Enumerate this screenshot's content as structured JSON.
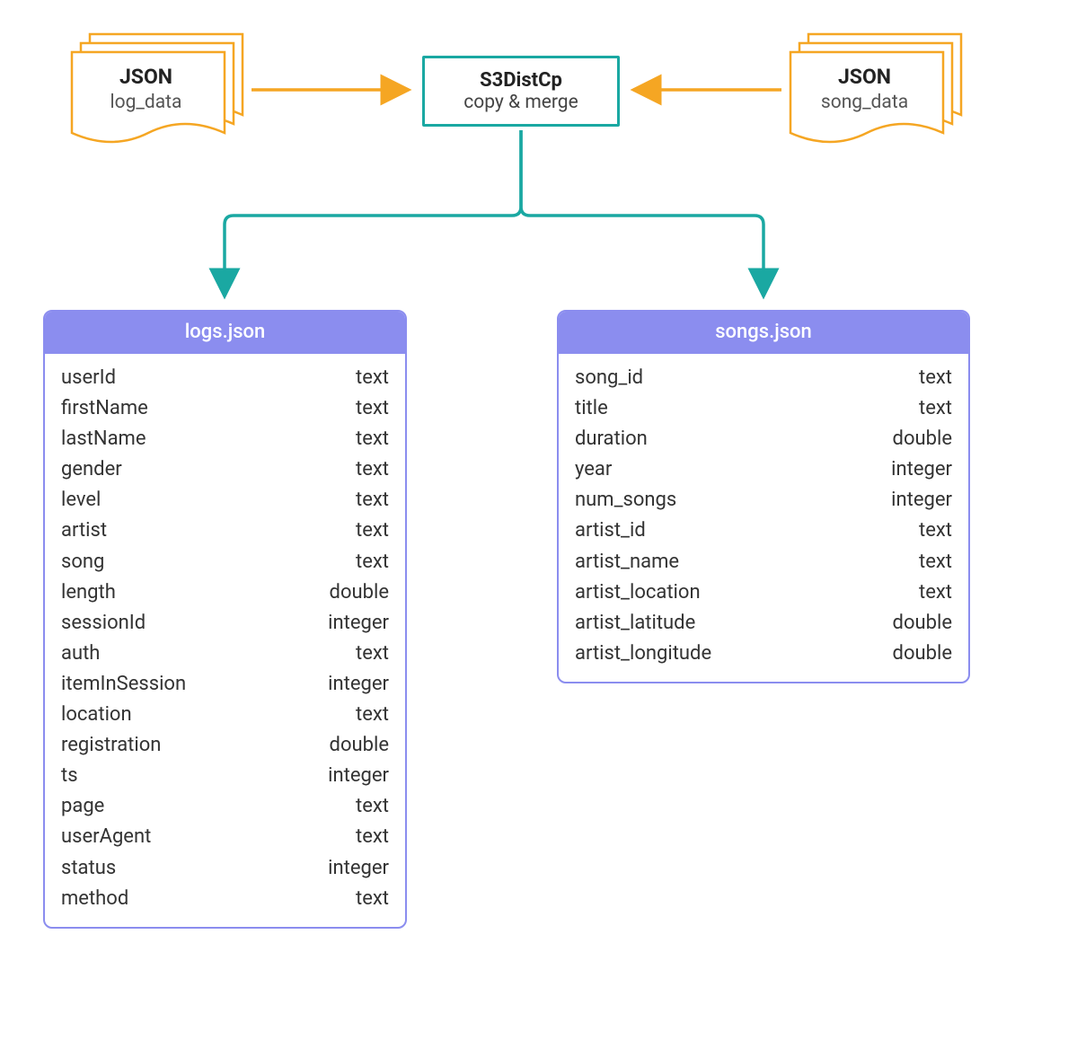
{
  "source_left": {
    "title": "JSON",
    "subtitle": "log_data"
  },
  "source_right": {
    "title": "JSON",
    "subtitle": "song_data"
  },
  "process": {
    "title": "S3DistCp",
    "subtitle": "copy & merge"
  },
  "tables": {
    "logs": {
      "header": "logs.json",
      "fields": [
        {
          "name": "userId",
          "type": "text"
        },
        {
          "name": "firstName",
          "type": "text"
        },
        {
          "name": "lastName",
          "type": "text"
        },
        {
          "name": "gender",
          "type": "text"
        },
        {
          "name": "level",
          "type": "text"
        },
        {
          "name": "artist",
          "type": "text"
        },
        {
          "name": "song",
          "type": "text"
        },
        {
          "name": "length",
          "type": "double"
        },
        {
          "name": "sessionId",
          "type": "integer"
        },
        {
          "name": "auth",
          "type": "text"
        },
        {
          "name": "itemInSession",
          "type": "integer"
        },
        {
          "name": "location",
          "type": "text"
        },
        {
          "name": "registration",
          "type": "double"
        },
        {
          "name": "ts",
          "type": "integer"
        },
        {
          "name": "page",
          "type": "text"
        },
        {
          "name": "userAgent",
          "type": "text"
        },
        {
          "name": "status",
          "type": "integer"
        },
        {
          "name": "method",
          "type": "text"
        }
      ]
    },
    "songs": {
      "header": "songs.json",
      "fields": [
        {
          "name": "song_id",
          "type": "text"
        },
        {
          "name": "title",
          "type": "text"
        },
        {
          "name": "duration",
          "type": "double"
        },
        {
          "name": "year",
          "type": "integer"
        },
        {
          "name": "num_songs",
          "type": "integer"
        },
        {
          "name": "artist_id",
          "type": "text"
        },
        {
          "name": "artist_name",
          "type": "text"
        },
        {
          "name": "artist_location",
          "type": "text"
        },
        {
          "name": "artist_latitude",
          "type": "double"
        },
        {
          "name": "artist_longitude",
          "type": "double"
        }
      ]
    }
  },
  "colors": {
    "orange": "#f5a623",
    "teal": "#1aa8a2",
    "purple": "#8b8def"
  }
}
